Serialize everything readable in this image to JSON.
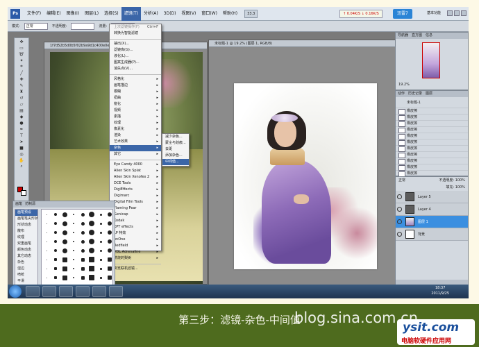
{
  "menubar": {
    "logo": "Ps",
    "items": [
      "文件(F)",
      "编辑(E)",
      "图像(I)",
      "图层(L)",
      "选择(S)",
      "滤镜(T)",
      "分析(A)",
      "3D(D)",
      "视图(V)",
      "窗口(W)",
      "帮助(H)"
    ],
    "active_index": 5,
    "zoom": "33.3",
    "notification": "↑ 0.04K/S ↓ 0.16K/S",
    "brand": "迅雷7",
    "workspace": "基本功能"
  },
  "options_bar": {
    "mode_label": "模式:",
    "mode_value": "正常",
    "opacity_label": "不透明度:",
    "flow_label": "流量:"
  },
  "filter_menu": {
    "items": [
      {
        "label": "上次滤镜操作(F)",
        "shortcut": "Ctrl+F",
        "dim": true
      },
      {
        "label": "转换为智能滤镜",
        "sep_after": true
      },
      {
        "label": "抽出(X)..."
      },
      {
        "label": "滤镜库(G)..."
      },
      {
        "label": "液化(L)..."
      },
      {
        "label": "图案生成器(P)..."
      },
      {
        "label": "消失点(V)...",
        "sep_after": true
      },
      {
        "label": "风格化",
        "arrow": true
      },
      {
        "label": "画笔描边",
        "arrow": true
      },
      {
        "label": "模糊",
        "arrow": true
      },
      {
        "label": "扭曲",
        "arrow": true
      },
      {
        "label": "锐化",
        "arrow": true
      },
      {
        "label": "视频",
        "arrow": true
      },
      {
        "label": "素描",
        "arrow": true
      },
      {
        "label": "纹理",
        "arrow": true
      },
      {
        "label": "像素化",
        "arrow": true
      },
      {
        "label": "渲染",
        "arrow": true
      },
      {
        "label": "艺术效果",
        "arrow": true
      },
      {
        "label": "杂色",
        "arrow": true,
        "highlight": true
      },
      {
        "label": "其它",
        "arrow": true,
        "sep_after": true
      },
      {
        "label": "Eye Candy 4000",
        "arrow": true
      },
      {
        "label": "Alien Skin Splat",
        "arrow": true
      },
      {
        "label": "Alien Skin Xenofex 2",
        "arrow": true
      },
      {
        "label": "DCE Tools",
        "arrow": true
      },
      {
        "label": "DigiEffects",
        "arrow": true
      },
      {
        "label": "Digimarc",
        "arrow": true
      },
      {
        "label": "Digital Film Tools",
        "arrow": true
      },
      {
        "label": "Flaming Pear",
        "arrow": true
      },
      {
        "label": "Genicap",
        "arrow": true
      },
      {
        "label": "Kodak",
        "arrow": true
      },
      {
        "label": "KPT effects",
        "arrow": true
      },
      {
        "label": "LP 特效",
        "arrow": true
      },
      {
        "label": "onOne",
        "arrow": true
      },
      {
        "label": "Redfield",
        "arrow": true
      },
      {
        "label": "VDL Adrenaline",
        "arrow": true
      },
      {
        "label": "燃烧的梨树",
        "arrow": true,
        "sep_after": true
      },
      {
        "label": "浏览联机滤镜..."
      }
    ]
  },
  "noise_submenu": {
    "items": [
      {
        "label": "减少杂色..."
      },
      {
        "label": "蒙尘与划痕..."
      },
      {
        "label": "去斑"
      },
      {
        "label": "添加杂色..."
      },
      {
        "label": "中间值...",
        "highlight": true
      }
    ]
  },
  "doc1": {
    "title": "1f7d52b5d0b5f02b9a9d1c400e0e9f5d.jpg @ 33.3%"
  },
  "doc2": {
    "title": "未标题-1 @ 19.2% (图层 1, RGB/8)"
  },
  "brush_panel": {
    "tabs": [
      "画笔",
      "仿制源"
    ],
    "list": [
      "画笔预设",
      "画笔笔尖形状",
      "形状动态",
      "散布",
      "纹理",
      "双重画笔",
      "颜色动态",
      "其它动态",
      "杂色",
      "湿边",
      "喷枪",
      "平滑",
      "保护纹理"
    ],
    "selected": 0
  },
  "navigator": {
    "tabs": [
      "导航器",
      "直方图",
      "信息"
    ],
    "zoom": "19.2%"
  },
  "history": {
    "tabs": [
      "动作",
      "历史记录",
      "图层"
    ],
    "snapshot": "未标题-1",
    "rows": [
      "橡皮擦",
      "橡皮擦",
      "橡皮擦",
      "橡皮擦",
      "橡皮擦",
      "橡皮擦",
      "橡皮擦",
      "橡皮擦",
      "橡皮擦",
      "橡皮擦",
      "橡皮擦"
    ]
  },
  "layers": {
    "blend": "正常",
    "opacity_label": "不透明度: 100%",
    "fill_label": "填充: 100%",
    "rows": [
      {
        "name": "Layer 5"
      },
      {
        "name": "Layer 4"
      },
      {
        "name": "图层 1",
        "selected": true
      },
      {
        "name": "背景",
        "background": true
      }
    ]
  },
  "taskbar": {
    "time": "18:37",
    "date": "2011/9/25"
  },
  "caption": {
    "text": "第三步：滤镜-杂色-中间值",
    "watermark_url": "blog.sina.com.cn",
    "logo_big": "ysit.com",
    "logo_small": "电脑软硬件应用网"
  }
}
